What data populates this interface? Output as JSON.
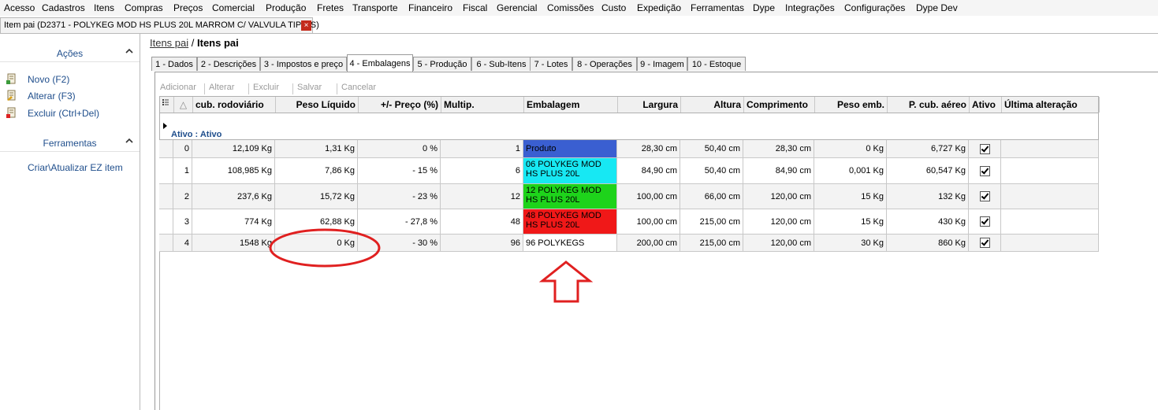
{
  "menu": [
    "Acesso",
    "Cadastros",
    "Itens",
    "Compras",
    "Preços",
    "Comercial",
    "Produção",
    "Fretes",
    "Transporte",
    "Financeiro",
    "Fiscal",
    "Gerencial",
    "Comissões",
    "Custo",
    "Expedição",
    "Ferramentas",
    "Dype",
    "Integrações",
    "Configurações",
    "Dype Dev"
  ],
  "doc_tab": {
    "title": "Item pai (D2371 - POLYKEG MOD HS PLUS 20L MARROM C/ VALVULA TIPO S)",
    "close": "×"
  },
  "sidebar": {
    "actions_title": "Ações",
    "actions": [
      {
        "label": "Novo (F2)",
        "icon": "new-document-icon"
      },
      {
        "label": "Alterar (F3)",
        "icon": "edit-document-icon"
      },
      {
        "label": "Excluir (Ctrl+Del)",
        "icon": "delete-document-icon"
      }
    ],
    "tools_title": "Ferramentas",
    "tools": [
      "Criar\\Atualizar EZ item"
    ]
  },
  "breadcrumb": {
    "parent": "Itens pai",
    "sep": " / ",
    "current": "Itens pai"
  },
  "tabs": [
    "1 - Dados",
    "2 - Descrições",
    "3 - Impostos e preço",
    "4 - Embalagens",
    "5 - Produção",
    "6 - Sub-Itens",
    "7 - Lotes",
    "8 - Operações",
    "9 - Imagem",
    "10 - Estoque"
  ],
  "active_tab": "4 - Embalagens",
  "toolbar": [
    "Adicionar",
    "Alterar",
    "Excluir",
    "Salvar",
    "Cancelar"
  ],
  "columns": [
    "",
    "△",
    "cub. rodoviário",
    "Peso Líquido",
    "+/- Preço (%)",
    "Multip.",
    "Embalagem",
    "Largura",
    "Altura",
    "Comprimento",
    "Peso emb.",
    "P. cub. aéreo",
    "Ativo",
    "Última alteração"
  ],
  "group_label": "Ativo : Ativo",
  "rows": [
    {
      "idx": "0",
      "cub": "12,109 Kg",
      "peso": "1,31 Kg",
      "preco": "0 %",
      "mult": "1",
      "emb": "Produto",
      "emb_color": "#3a5fd1",
      "larg": "28,30 cm",
      "alt": "50,40 cm",
      "comp": "28,30 cm",
      "pemb": "0 Kg",
      "aereo": "6,727 Kg",
      "ativo": true,
      "ult": ""
    },
    {
      "idx": "1",
      "cub": "108,985 Kg",
      "peso": "7,86 Kg",
      "preco": "- 15 %",
      "mult": "6",
      "emb": "06 POLYKEG MOD HS PLUS 20L",
      "emb_color": "#17e8f3",
      "larg": "84,90 cm",
      "alt": "50,40 cm",
      "comp": "84,90 cm",
      "pemb": "0,001 Kg",
      "aereo": "60,547 Kg",
      "ativo": true,
      "ult": ""
    },
    {
      "idx": "2",
      "cub": "237,6 Kg",
      "peso": "15,72 Kg",
      "preco": "- 23 %",
      "mult": "12",
      "emb": "12 POLYKEG MOD HS PLUS 20L",
      "emb_color": "#1ed31b",
      "larg": "100,00 cm",
      "alt": "66,00 cm",
      "comp": "120,00 cm",
      "pemb": "15 Kg",
      "aereo": "132 Kg",
      "ativo": true,
      "ult": ""
    },
    {
      "idx": "3",
      "cub": "774 Kg",
      "peso": "62,88 Kg",
      "preco": "- 27,8 %",
      "mult": "48",
      "emb": "48 POLYKEG MOD HS PLUS 20L",
      "emb_color": "#f01818",
      "larg": "100,00 cm",
      "alt": "215,00 cm",
      "comp": "120,00 cm",
      "pemb": "15 Kg",
      "aereo": "430 Kg",
      "ativo": true,
      "ult": ""
    },
    {
      "idx": "4",
      "cub": "1548 Kg",
      "peso": "0 Kg",
      "preco": "- 30 %",
      "mult": "96",
      "emb": "96 POLYKEGS",
      "emb_color": "#ffffff",
      "larg": "200,00 cm",
      "alt": "215,00 cm",
      "comp": "120,00 cm",
      "pemb": "30 Kg",
      "aereo": "860 Kg",
      "ativo": true,
      "ult": ""
    }
  ],
  "annotation_color": "#e02020"
}
